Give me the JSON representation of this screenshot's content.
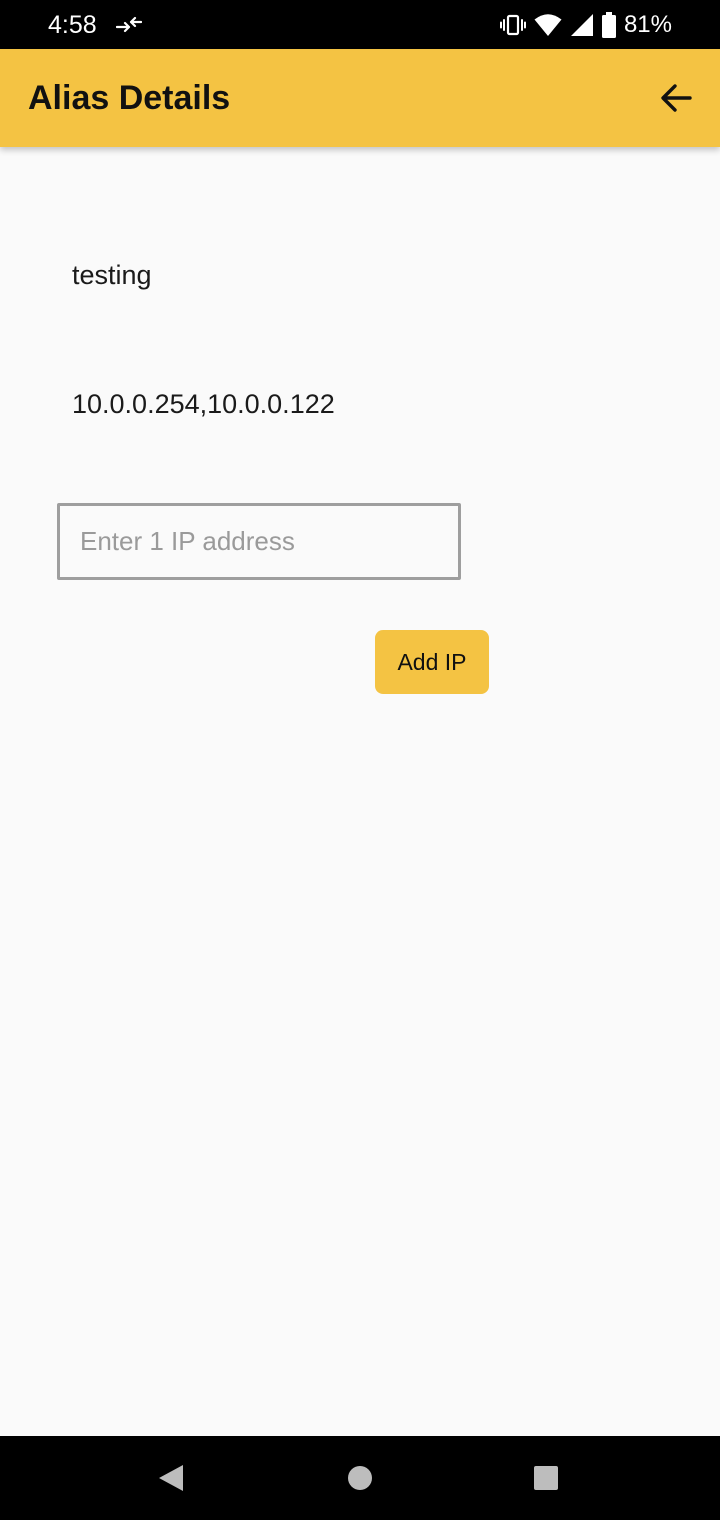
{
  "status_bar": {
    "time": "4:58",
    "battery_percent": "81%",
    "icons": [
      "data-transfer-icon",
      "vibrate-icon",
      "wifi-icon",
      "cell-signal-icon",
      "battery-icon"
    ]
  },
  "app_bar": {
    "title": "Alias Details",
    "back_icon": "arrow-left-icon",
    "color": "#f4c343"
  },
  "alias": {
    "name": "testing",
    "ips": "10.0.0.254,10.0.0.122"
  },
  "ip_input": {
    "value": "",
    "placeholder": "Enter 1 IP address"
  },
  "add_ip_button": {
    "label": "Add IP",
    "color": "#f4c343"
  },
  "nav_bar": {
    "icons": [
      "nav-back-icon",
      "nav-home-icon",
      "nav-recents-icon"
    ]
  }
}
